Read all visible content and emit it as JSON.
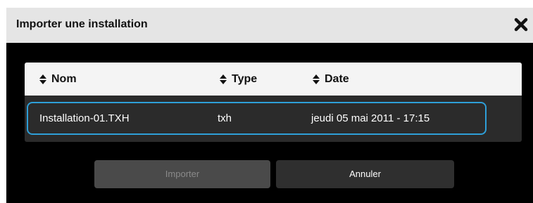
{
  "dialog": {
    "title": "Importer une installation",
    "close_icon": "close-icon"
  },
  "table": {
    "columns": [
      {
        "label": "Nom",
        "icon": "sort-icon"
      },
      {
        "label": "Type",
        "icon": "sort-icon"
      },
      {
        "label": "Date",
        "icon": "sort-icon"
      }
    ],
    "rows": [
      {
        "nom": "Installation-01.TXH",
        "type": "txh",
        "date": "jeudi 05 mai 2011 - 17:15",
        "selected": true
      }
    ]
  },
  "buttons": {
    "import_label": "Importer",
    "import_enabled": false,
    "cancel_label": "Annuler"
  },
  "colors": {
    "titlebar_bg": "#e5e5e5",
    "dialog_bg": "#000000",
    "selection_border": "#2e9fd8",
    "row_bg": "#2b2b2b"
  }
}
